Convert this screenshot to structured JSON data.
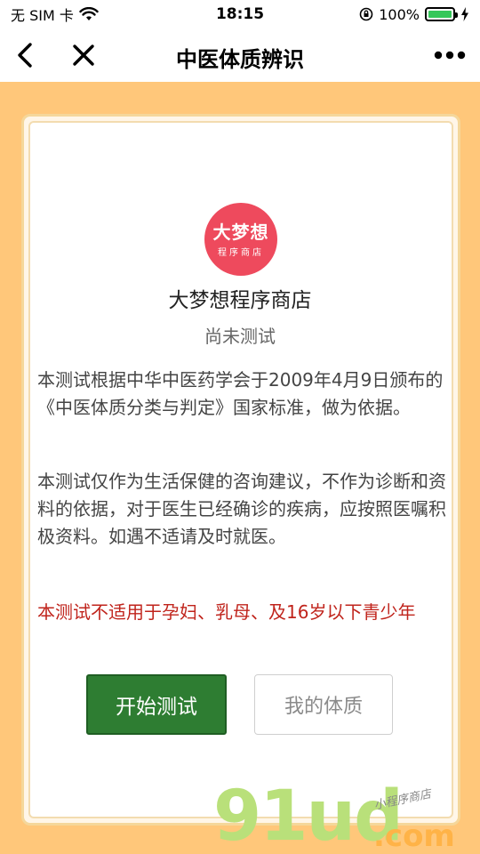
{
  "status_bar": {
    "carrier": "无 SIM 卡",
    "time": "18:15",
    "battery_percent": "100%",
    "battery_level": 1.0
  },
  "nav": {
    "title": "中医体质辨识",
    "back_icon": "chevron-left-icon",
    "close_icon": "close-icon",
    "more_icon": "more-dots-icon"
  },
  "shop": {
    "logo_main": "大梦想",
    "logo_sub": "程序商店",
    "name": "大梦想程序商店",
    "status": "尚未测试"
  },
  "content": {
    "para1": "本测试根据中华中医药学会于2009年4月9日颁布的《中医体质分类与判定》国家标准，做为依据。",
    "para2": "本测试仅作为生活保健的咨询建议，不作为诊断和资料的依据，对于医生已经确诊的疾病，应按照医嘱积极资料。如遇不适请及时就医。",
    "warning": "本测试不适用于孕妇、乳母、及16岁以下青少年"
  },
  "buttons": {
    "start": "开始测试",
    "mine": "我的体质"
  },
  "watermark": {
    "main": "91ud",
    "com": ".com",
    "tag": "小程序商店"
  },
  "colors": {
    "background": "#ffc77a",
    "primary_button": "#2e7d32",
    "warning_text": "#c0241c",
    "logo": "#ee4a5d"
  }
}
